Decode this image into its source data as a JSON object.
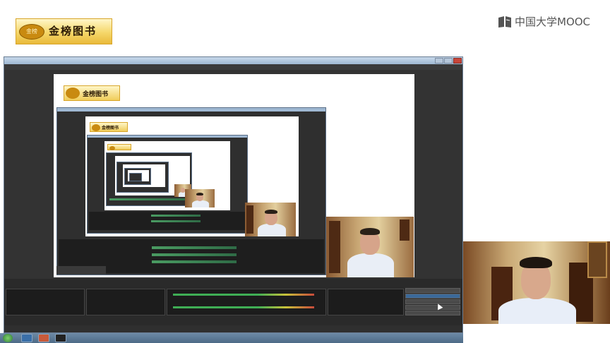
{
  "header": {
    "publisher_logo_text": "金榜图书",
    "publisher_badge": "金榜",
    "publisher_tagline": "",
    "platform_name": "中国大学MOOC"
  },
  "obs_window": {
    "title": "",
    "menu_items": [],
    "panels": {
      "scenes_label": "",
      "sources_label": "",
      "mixer_label": "",
      "transitions_label": "",
      "controls_label": ""
    },
    "control_buttons": [
      "",
      "",
      "",
      "",
      "",
      ""
    ],
    "status": {
      "left": "",
      "right": ""
    }
  },
  "taskbar": {
    "time": "",
    "date": ""
  },
  "colors": {
    "logo_gold": "#e9b93a",
    "obs_background": "#2e2e2e",
    "title_bar": "#9fb8d2",
    "meter_green": "#3fae55",
    "highlight_blue": "#3c6a9a"
  },
  "icons": {
    "mooc_logo": "book-icon",
    "start_button": "windows-start-icon",
    "cursor": "mouse-pointer-icon"
  }
}
